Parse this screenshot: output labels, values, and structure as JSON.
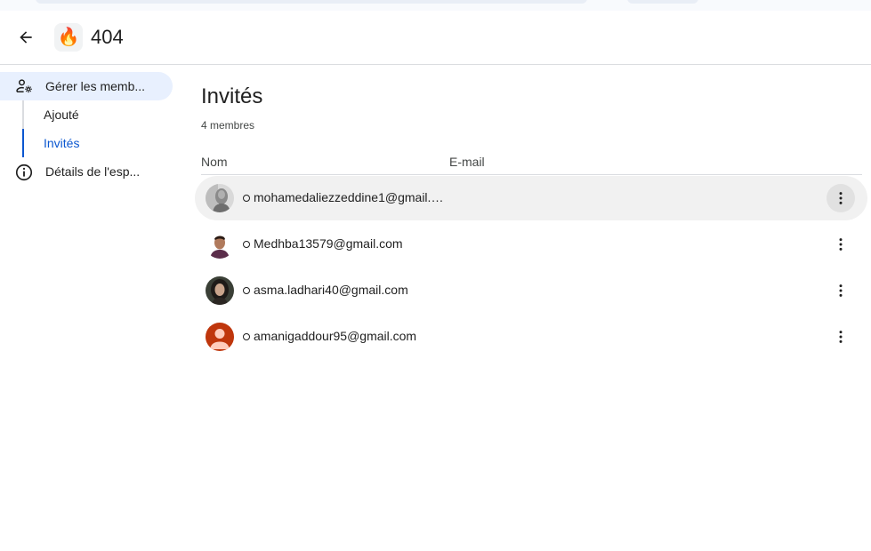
{
  "header": {
    "space_emoji": "🔥",
    "space_title": "404"
  },
  "sidebar": {
    "manage_members_label": "Gérer les memb...",
    "sub_items": [
      {
        "label": "Ajouté"
      },
      {
        "label": "Invités",
        "active": true
      }
    ],
    "details_label": "Détails de l'esp..."
  },
  "main": {
    "title": "Invités",
    "member_count": "4 membres",
    "columns": {
      "name": "Nom",
      "email": "E-mail"
    },
    "members": [
      {
        "email": "mohamedaliezzeddine1@gmail.com",
        "avatar": "photo-gray"
      },
      {
        "email": "Medhba13579@gmail.com",
        "avatar": "photo-man"
      },
      {
        "email": "asma.ladhari40@gmail.com",
        "avatar": "photo-woman"
      },
      {
        "email": "amanigaddour95@gmail.com",
        "avatar": "default-person"
      }
    ]
  },
  "colors": {
    "accent": "#0b57d0",
    "active_nav_bg": "#e8f0fe",
    "row_hover_bg": "#f1f1f1"
  }
}
